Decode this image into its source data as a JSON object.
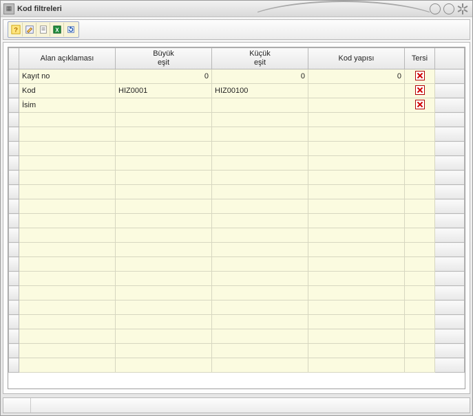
{
  "window": {
    "title": "Kod filtreleri"
  },
  "toolbar": {
    "buttons": [
      {
        "name": "help-icon"
      },
      {
        "name": "edit-icon"
      },
      {
        "name": "document-icon"
      },
      {
        "name": "excel-icon"
      },
      {
        "name": "reset-icon"
      }
    ]
  },
  "grid": {
    "headers": {
      "field_desc": "Alan açıklaması",
      "ge": "Büyük\neşit",
      "le": "Küçük\neşit",
      "struct": "Kod yapısı",
      "reverse": "Tersi"
    },
    "rows": [
      {
        "desc": "Kayıt no",
        "ge": "0",
        "le": "0",
        "struct": "0",
        "reverse": true,
        "ge_numeric": true,
        "le_numeric": true,
        "struct_numeric": true
      },
      {
        "desc": "Kod",
        "ge": "HIZ0001",
        "le": "HIZ00100",
        "struct": "",
        "reverse": true
      },
      {
        "desc": "İsim",
        "ge": "",
        "le": "",
        "struct": "",
        "reverse": true
      },
      {
        "desc": "",
        "ge": "",
        "le": "",
        "struct": "",
        "reverse": false
      },
      {
        "desc": "",
        "ge": "",
        "le": "",
        "struct": "",
        "reverse": false
      },
      {
        "desc": "",
        "ge": "",
        "le": "",
        "struct": "",
        "reverse": false
      },
      {
        "desc": "",
        "ge": "",
        "le": "",
        "struct": "",
        "reverse": false
      },
      {
        "desc": "",
        "ge": "",
        "le": "",
        "struct": "",
        "reverse": false
      },
      {
        "desc": "",
        "ge": "",
        "le": "",
        "struct": "",
        "reverse": false
      },
      {
        "desc": "",
        "ge": "",
        "le": "",
        "struct": "",
        "reverse": false
      },
      {
        "desc": "",
        "ge": "",
        "le": "",
        "struct": "",
        "reverse": false
      },
      {
        "desc": "",
        "ge": "",
        "le": "",
        "struct": "",
        "reverse": false
      },
      {
        "desc": "",
        "ge": "",
        "le": "",
        "struct": "",
        "reverse": false
      },
      {
        "desc": "",
        "ge": "",
        "le": "",
        "struct": "",
        "reverse": false
      },
      {
        "desc": "",
        "ge": "",
        "le": "",
        "struct": "",
        "reverse": false
      },
      {
        "desc": "",
        "ge": "",
        "le": "",
        "struct": "",
        "reverse": false
      },
      {
        "desc": "",
        "ge": "",
        "le": "",
        "struct": "",
        "reverse": false
      },
      {
        "desc": "",
        "ge": "",
        "le": "",
        "struct": "",
        "reverse": false
      },
      {
        "desc": "",
        "ge": "",
        "le": "",
        "struct": "",
        "reverse": false
      },
      {
        "desc": "",
        "ge": "",
        "le": "",
        "struct": "",
        "reverse": false
      },
      {
        "desc": "",
        "ge": "",
        "le": "",
        "struct": "",
        "reverse": false
      }
    ]
  }
}
